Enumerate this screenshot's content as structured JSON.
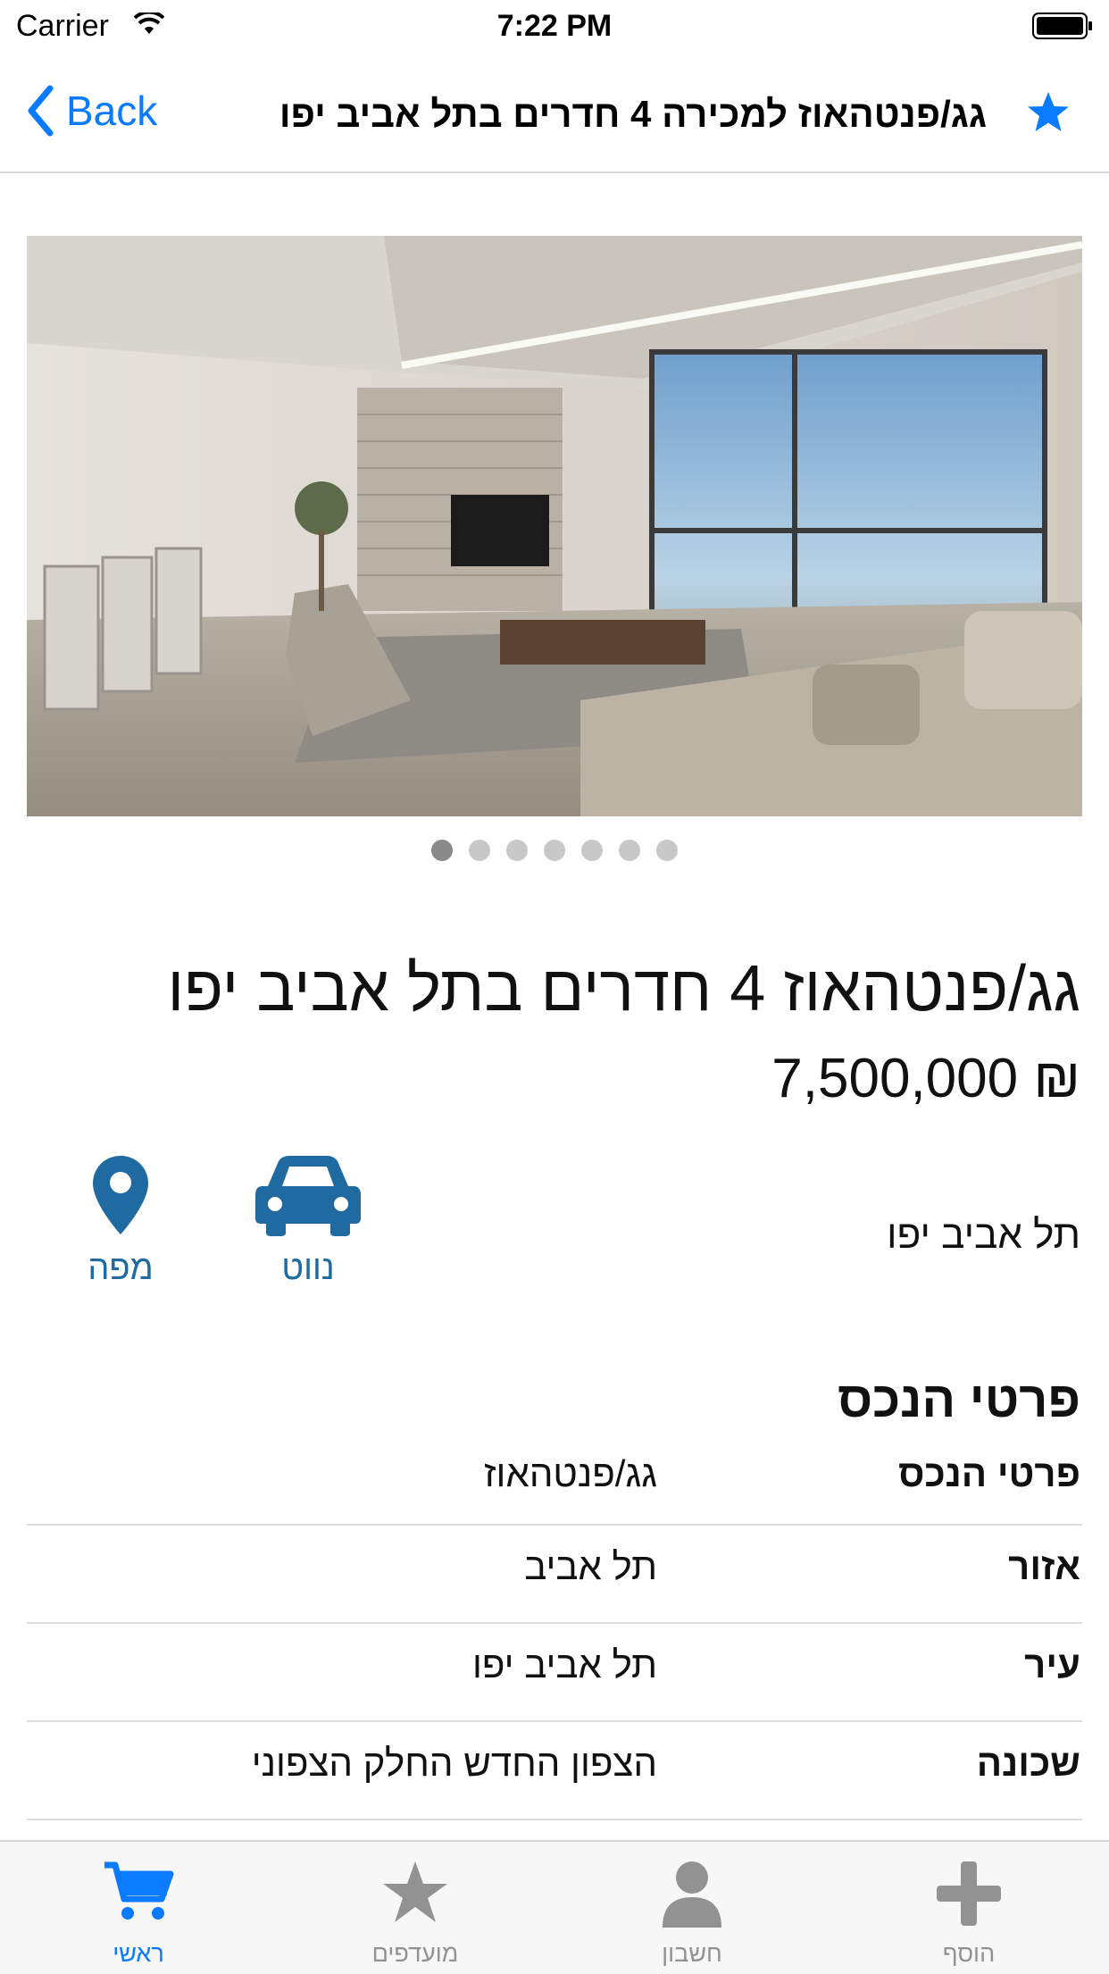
{
  "status_bar": {
    "carrier": "Carrier",
    "time": "7:22 PM"
  },
  "nav": {
    "back_label": "Back",
    "title": "גג/פנטהאוז למכירה 4 חדרים בתל אביב יפו",
    "favorite_icon": "star-icon"
  },
  "gallery": {
    "photo_count": 7,
    "current_index": 0
  },
  "listing": {
    "title": "גג/פנטהאוז 4 חדרים בתל אביב יפו",
    "price": "7,500,000 ₪",
    "city": "תל אביב יפו",
    "actions": [
      {
        "label": "נווט",
        "icon": "car-icon"
      },
      {
        "label": "מפה",
        "icon": "map-pin-icon"
      }
    ]
  },
  "details": {
    "section_title": "פרטי הנכס",
    "rows": [
      {
        "key": "פרטי הנכס",
        "value": "גג/פנטהאוז"
      },
      {
        "key": "אזור",
        "value": "תל אביב"
      },
      {
        "key": "עיר",
        "value": "תל אביב יפו"
      },
      {
        "key": "שכונה",
        "value": "הצפון החדש החלק הצפוני"
      }
    ]
  },
  "tabbar": {
    "tabs": [
      {
        "label": "ראשי",
        "icon": "cart-icon",
        "active": true
      },
      {
        "label": "מועדפים",
        "icon": "star-icon",
        "active": false
      },
      {
        "label": "חשבון",
        "icon": "user-icon",
        "active": false
      },
      {
        "label": "הוסף",
        "icon": "plus-icon",
        "active": false
      }
    ]
  },
  "colors": {
    "accent": "#0a7bff",
    "action_blue": "#1f6aa0",
    "inactive_gray": "#929292"
  }
}
